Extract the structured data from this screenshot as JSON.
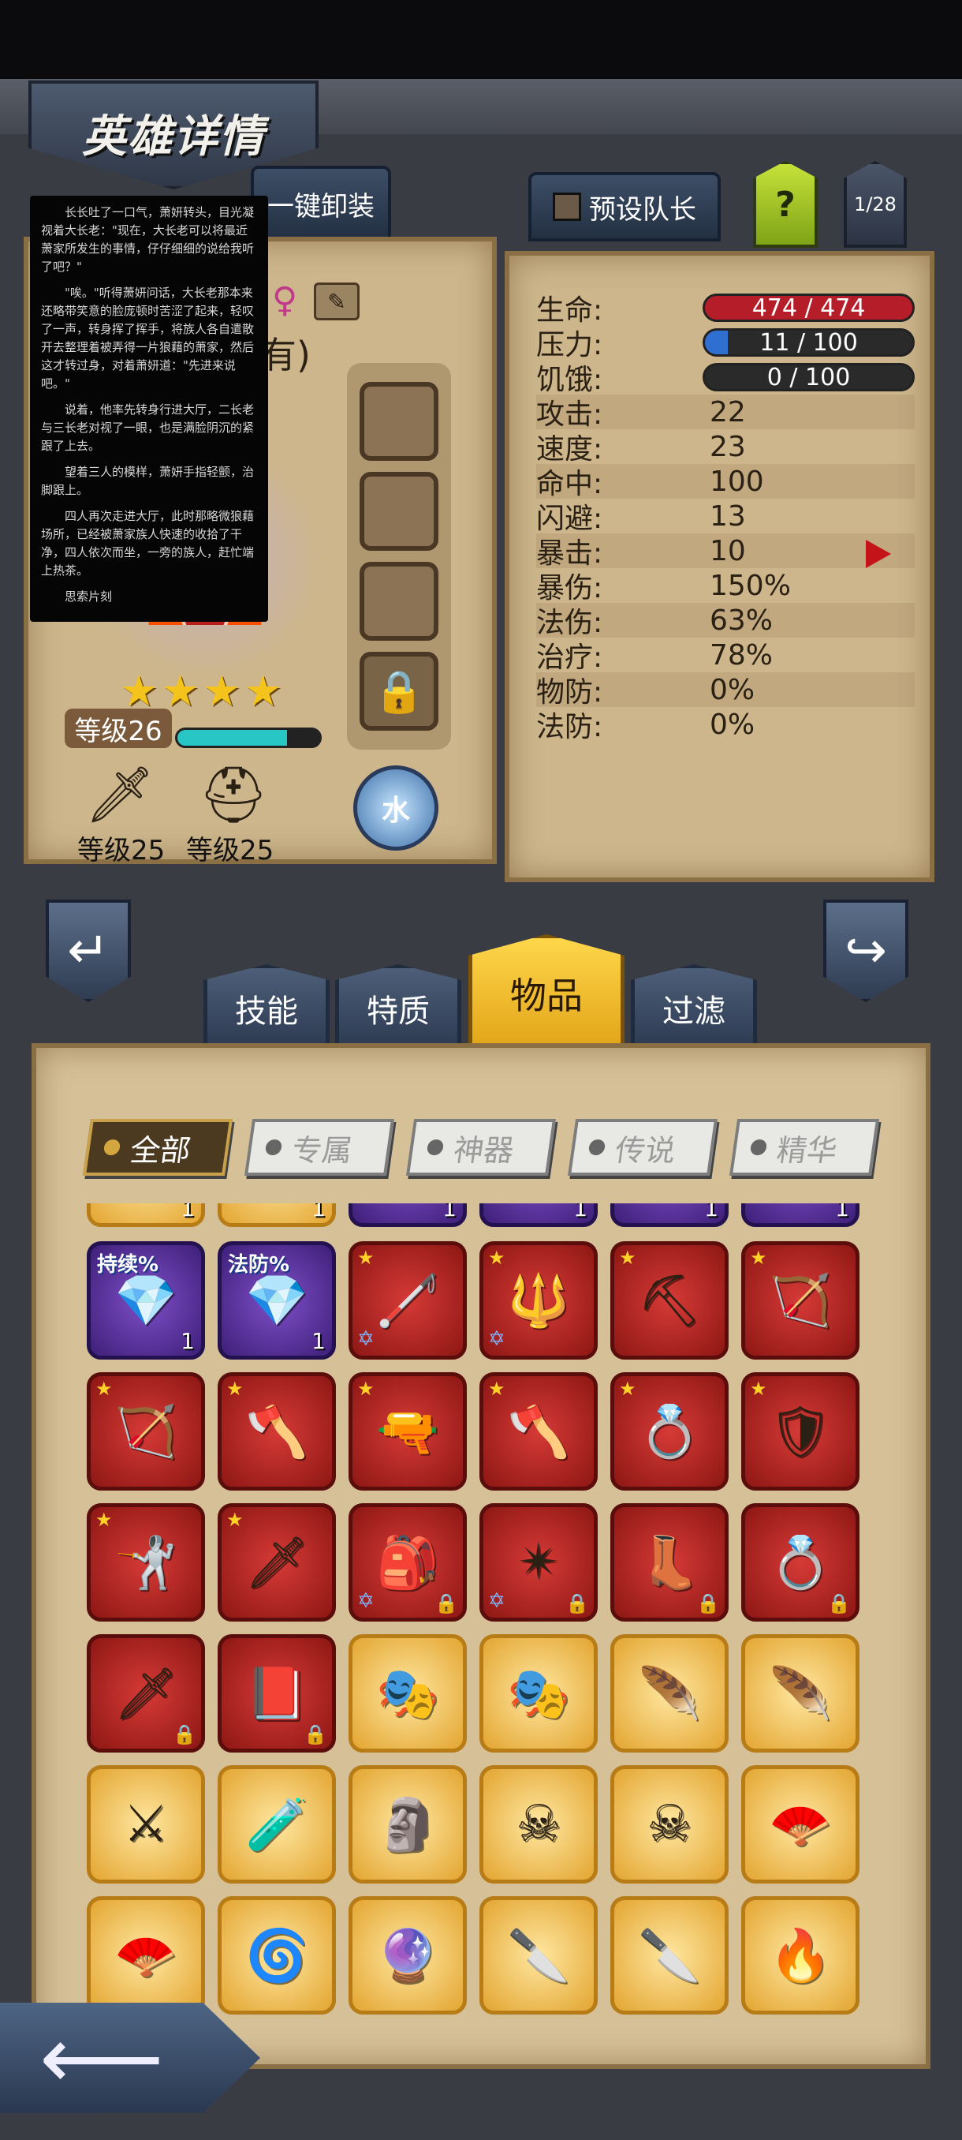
{
  "header": {
    "title": "英雄详情"
  },
  "top_tabs": {
    "unequip_all": "一键卸装",
    "preset_leader": "预设队长",
    "help": "?",
    "page": "1/28"
  },
  "novel": {
    "paragraphs": [
      "长长吐了一口气，萧妍转头，目光凝视着大长老：\"现在，大长老可以将最近萧家所发生的事情，仔仔细细的说给我听了吧？\"",
      "\"唉。\"听得萧妍问话，大长老那本来还略带笑意的脸庞顿时苦涩了起来，轻叹了一声，转身挥了挥手，将族人各自遣散开去整理着被弄得一片狼藉的萧家，然后这才转过身，对着萧妍道：\"先进来说吧。\"",
      "说着，他率先转身行进大厅，二长老与三长老对视了一眼，也是满脸阴沉的紧跟了上去。",
      "望着三人的模样，萧妍手指轻颤，治脚跟上。",
      "四人再次走进大厅，此时那略微狼藉场所，已经被萧家族人快速的收拾了干净，四人依次而坐，一旁的族人，赶忙端上热茶。",
      "思索片刻",
      ""
    ]
  },
  "hero": {
    "name_fragment": "有)",
    "stars": 4,
    "level_label": "等级26",
    "xp_fraction": 0.77,
    "weapon_level": "等级25",
    "helmet_level": "等级25",
    "element": "水"
  },
  "stats": {
    "hp": {
      "label": "生命:",
      "value": "474 / 474",
      "fill": 1.0,
      "color": "#c8202c"
    },
    "stress": {
      "label": "压力:",
      "value": "11 / 100",
      "fill": 0.11,
      "color": "#2e6fd1"
    },
    "hunger": {
      "label": "饥饿:",
      "value": "0 / 100",
      "fill": 0.0,
      "color": "#2e6fd1"
    },
    "rows": [
      {
        "label": "攻击:",
        "value": "22"
      },
      {
        "label": "速度:",
        "value": "23"
      },
      {
        "label": "命中:",
        "value": "100"
      },
      {
        "label": "闪避:",
        "value": "13"
      },
      {
        "label": "暴击:",
        "value": "10"
      },
      {
        "label": "暴伤:",
        "value": "150%"
      },
      {
        "label": "法伤:",
        "value": "63%"
      },
      {
        "label": "治疗:",
        "value": "78%"
      },
      {
        "label": "物防:",
        "value": "0%"
      },
      {
        "label": "法防:",
        "value": "0%"
      }
    ]
  },
  "mid_tabs": [
    "技能",
    "特质",
    "物品",
    "过滤"
  ],
  "filters": [
    "全部",
    "专属",
    "神器",
    "传说",
    "精华"
  ],
  "items": {
    "top_counts": [
      "1",
      "1",
      "1",
      "1",
      "1",
      "1"
    ],
    "rows": [
      [
        {
          "rarity": "purple",
          "icon": "green-gem-icon",
          "glyph": "💎",
          "badge": "持续%",
          "count": "1"
        },
        {
          "rarity": "purple",
          "icon": "green-gem-icon",
          "glyph": "💎",
          "badge": "法防%",
          "count": "1"
        },
        {
          "rarity": "red",
          "icon": "staff-icon",
          "glyph": "🦯",
          "star": true,
          "hexagram": true
        },
        {
          "rarity": "red",
          "icon": "scepter-icon",
          "glyph": "🔱",
          "star": true,
          "hexagram": true
        },
        {
          "rarity": "red",
          "icon": "pickaxe-icon",
          "glyph": "⛏",
          "star": true
        },
        {
          "rarity": "red",
          "icon": "bow-icon",
          "glyph": "🏹",
          "star": true
        }
      ],
      [
        {
          "rarity": "red",
          "icon": "crossbow-icon",
          "glyph": "🏹",
          "star": true
        },
        {
          "rarity": "red",
          "icon": "axe-icon",
          "glyph": "🪓",
          "star": true
        },
        {
          "rarity": "red",
          "icon": "rifle-icon",
          "glyph": "🔫",
          "star": true
        },
        {
          "rarity": "red",
          "icon": "war-axe-icon",
          "glyph": "🪓",
          "star": true
        },
        {
          "rarity": "red",
          "icon": "ring-icon",
          "glyph": "💍",
          "star": true
        },
        {
          "rarity": "red",
          "icon": "armor-icon",
          "glyph": "🛡",
          "star": true
        }
      ],
      [
        {
          "rarity": "red",
          "icon": "rapier-icon",
          "glyph": "🤺",
          "star": true
        },
        {
          "rarity": "red",
          "icon": "dagger-icon",
          "glyph": "🗡",
          "star": true
        },
        {
          "rarity": "red",
          "icon": "backpack-icon",
          "glyph": "🎒",
          "hexagram": true,
          "locked": true
        },
        {
          "rarity": "red",
          "icon": "shuriken-icon",
          "glyph": "✴",
          "hexagram": true,
          "locked": true
        },
        {
          "rarity": "red",
          "icon": "winged-boots-icon",
          "glyph": "👢",
          "locked": true
        },
        {
          "rarity": "red",
          "icon": "jeweled-ring-icon",
          "glyph": "💍",
          "locked": true
        }
      ],
      [
        {
          "rarity": "red",
          "icon": "spear-icon",
          "glyph": "🗡",
          "locked": true
        },
        {
          "rarity": "red",
          "icon": "spellbook-icon",
          "glyph": "📕",
          "locked": true
        },
        {
          "rarity": "gold",
          "icon": "plague-mask-icon",
          "glyph": "🎭"
        },
        {
          "rarity": "gold",
          "icon": "plague-mask-icon",
          "glyph": "🎭"
        },
        {
          "rarity": "gold",
          "icon": "feather-mask-icon",
          "glyph": "🪶"
        },
        {
          "rarity": "gold",
          "icon": "feather-mask-icon",
          "glyph": "🪶"
        }
      ],
      [
        {
          "rarity": "gold",
          "icon": "crossed-swords-icon",
          "glyph": "⚔"
        },
        {
          "rarity": "gold",
          "icon": "potion-icon",
          "glyph": "🧪"
        },
        {
          "rarity": "gold",
          "icon": "statue-icon",
          "glyph": "🗿"
        },
        {
          "rarity": "gold",
          "icon": "skull-flag-icon",
          "glyph": "☠"
        },
        {
          "rarity": "gold",
          "icon": "skull-flag-icon",
          "glyph": "☠"
        },
        {
          "rarity": "gold",
          "icon": "feather-fan-icon",
          "glyph": "🪭"
        }
      ],
      [
        {
          "rarity": "gold",
          "icon": "feather-fan-icon",
          "glyph": "🪭"
        },
        {
          "rarity": "gold",
          "icon": "swirl-spear-icon",
          "glyph": "🌀"
        },
        {
          "rarity": "gold",
          "icon": "orb-staff-icon",
          "glyph": "🔮"
        },
        {
          "rarity": "gold",
          "icon": "curved-blade-icon",
          "glyph": "🔪"
        },
        {
          "rarity": "gold",
          "icon": "curved-blade-icon",
          "glyph": "🔪"
        },
        {
          "rarity": "gold",
          "icon": "flame-sword-icon",
          "glyph": "🔥"
        }
      ]
    ]
  }
}
